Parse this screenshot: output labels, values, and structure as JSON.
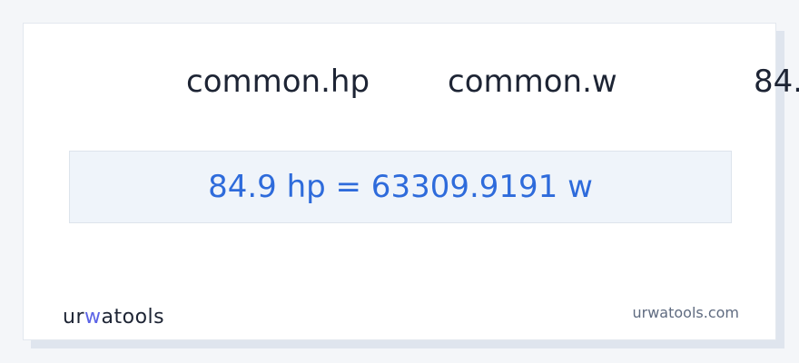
{
  "converter": {
    "from_unit": "common.hp",
    "to_unit": "common.w",
    "input_value_partial": "84.",
    "result": "84.9 hp = 63309.9191 w"
  },
  "footer": {
    "logo_prefix": "ur",
    "logo_accent": "w",
    "logo_suffix": "atools",
    "site_url": "urwatools.com"
  },
  "colors": {
    "accent": "#2e6bdb",
    "logo_accent": "#5b63e6",
    "text": "#1d2434",
    "result_bg": "#eff4fa"
  }
}
